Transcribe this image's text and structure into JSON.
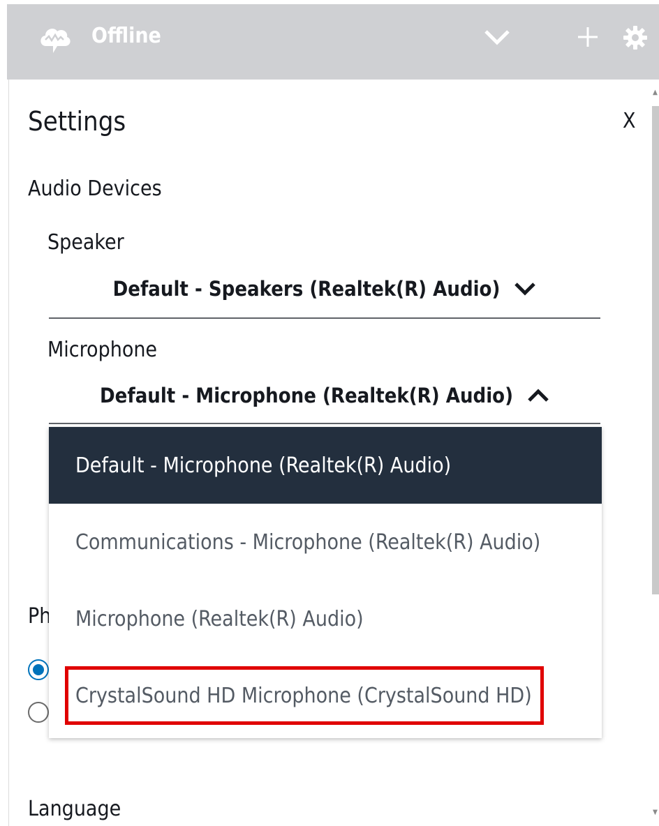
{
  "header": {
    "status": "Offline",
    "icons": [
      "cloud-logo-icon",
      "chevron-down-icon",
      "plus-icon",
      "gear-icon"
    ]
  },
  "settings": {
    "title": "Settings",
    "close_label": "X",
    "audio_devices": {
      "heading": "Audio Devices",
      "speaker": {
        "label": "Speaker",
        "selected": "Default - Speakers (Realtek(R) Audio)"
      },
      "microphone": {
        "label": "Microphone",
        "selected": "Default - Microphone (Realtek(R) Audio)",
        "options": [
          "Default - Microphone (Realtek(R) Audio)",
          "Communications - Microphone (Realtek(R) Audio)",
          "Microphone (Realtek(R) Audio)",
          "CrystalSound HD Microphone (CrystalSound HD)"
        ]
      }
    },
    "phone_label_partial": "Ph",
    "language_heading": "Language"
  },
  "colors": {
    "topbar": "#cfd0d3",
    "selected_option_bg": "#232f3e",
    "highlight_border": "#e00000",
    "radio_accent": "#0073bb"
  }
}
